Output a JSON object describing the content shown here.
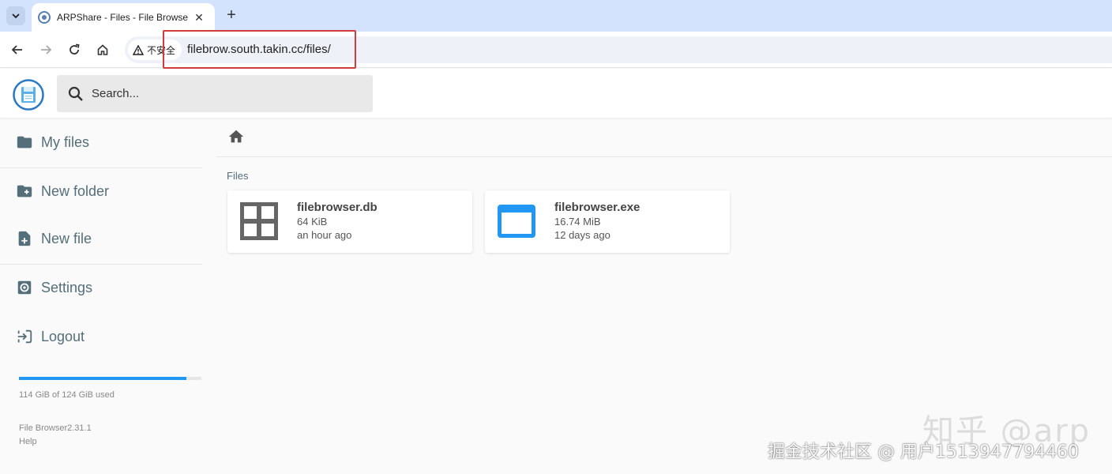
{
  "browser": {
    "tab_title": "ARPShare - Files - File Browser",
    "security_label": "不安全",
    "url": "filebrow.south.takin.cc/files/"
  },
  "header": {
    "search_placeholder": "Search..."
  },
  "sidebar": {
    "items": [
      {
        "label": "My files",
        "icon": "folder-icon"
      },
      {
        "label": "New folder",
        "icon": "create-new-folder-icon"
      },
      {
        "label": "New file",
        "icon": "note-add-icon"
      },
      {
        "label": "Settings",
        "icon": "settings-icon"
      },
      {
        "label": "Logout",
        "icon": "exit-to-app-icon"
      }
    ],
    "usage_fraction": 0.919,
    "usage_text": "114 GiB of 124 GiB used",
    "version": "File Browser2.31.1",
    "help": "Help"
  },
  "main": {
    "section_title": "Files",
    "files": [
      {
        "name": "filebrowser.db",
        "size": "64 KiB",
        "modified": "an hour ago",
        "icon": "grid-icon"
      },
      {
        "name": "filebrowser.exe",
        "size": "16.74 MiB",
        "modified": "12 days ago",
        "icon": "web-app-icon"
      }
    ]
  },
  "colors": {
    "accent": "#2196f3",
    "sidebar_text": "#546e7a",
    "highlight_box": "#d23b3b"
  },
  "watermark": {
    "large": "知乎 @arp",
    "small": "掘金技术社区 @ 用户1513947794460"
  }
}
